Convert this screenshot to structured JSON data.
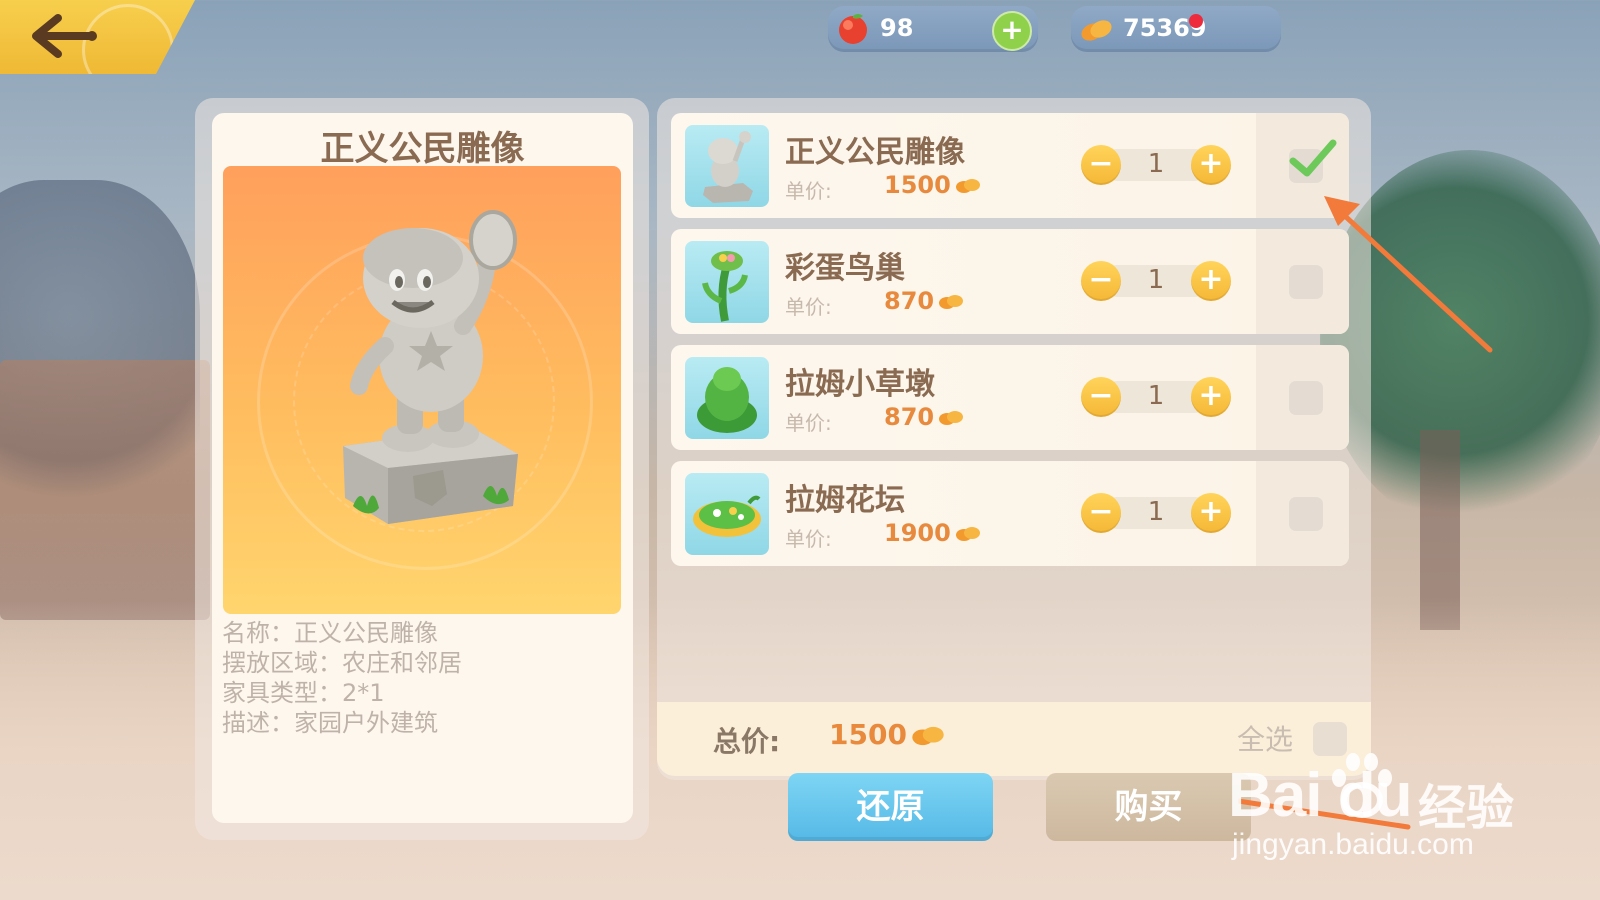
{
  "colors": {
    "accent_yellow": "#f5b736",
    "price_orange": "#e88a3e",
    "title_brown": "#8a6b52",
    "restore_blue": "#55b9e6",
    "check_green": "#6cc95a",
    "annotation_orange": "#f27a3a"
  },
  "topbar": {
    "back_icon": "back-arrow-icon",
    "peach": {
      "icon": "peach-icon",
      "value": "98",
      "plus_icon": "plus-icon"
    },
    "beans": {
      "icon": "bean-icon",
      "value": "75369"
    }
  },
  "detail": {
    "title": "正义公民雕像",
    "info": [
      {
        "label": "名称：",
        "value": "正义公民雕像"
      },
      {
        "label": "摆放区域：",
        "value": "农庄和邻居"
      },
      {
        "label": "家具类型：",
        "value": "2*1"
      },
      {
        "label": "描述：",
        "value": "家园户外建筑"
      }
    ]
  },
  "items": [
    {
      "name": "正义公民雕像",
      "price_label": "单价:",
      "price": "1500",
      "qty": "1",
      "checked": true,
      "thumb": "statue"
    },
    {
      "name": "彩蛋鸟巢",
      "price_label": "单价:",
      "price": "870",
      "qty": "1",
      "checked": false,
      "thumb": "nest"
    },
    {
      "name": "拉姆小草墩",
      "price_label": "单价:",
      "price": "870",
      "qty": "1",
      "checked": false,
      "thumb": "bush"
    },
    {
      "name": "拉姆花坛",
      "price_label": "单价:",
      "price": "1900",
      "qty": "1",
      "checked": false,
      "thumb": "flowerbed"
    }
  ],
  "total": {
    "label": "总价:",
    "value": "1500",
    "select_all": "全选"
  },
  "buttons": {
    "restore": "还原",
    "buy": "购买"
  },
  "watermark": {
    "logo": "Bai  du",
    "cn": "经验",
    "url": "jingyan.baidu.com"
  }
}
